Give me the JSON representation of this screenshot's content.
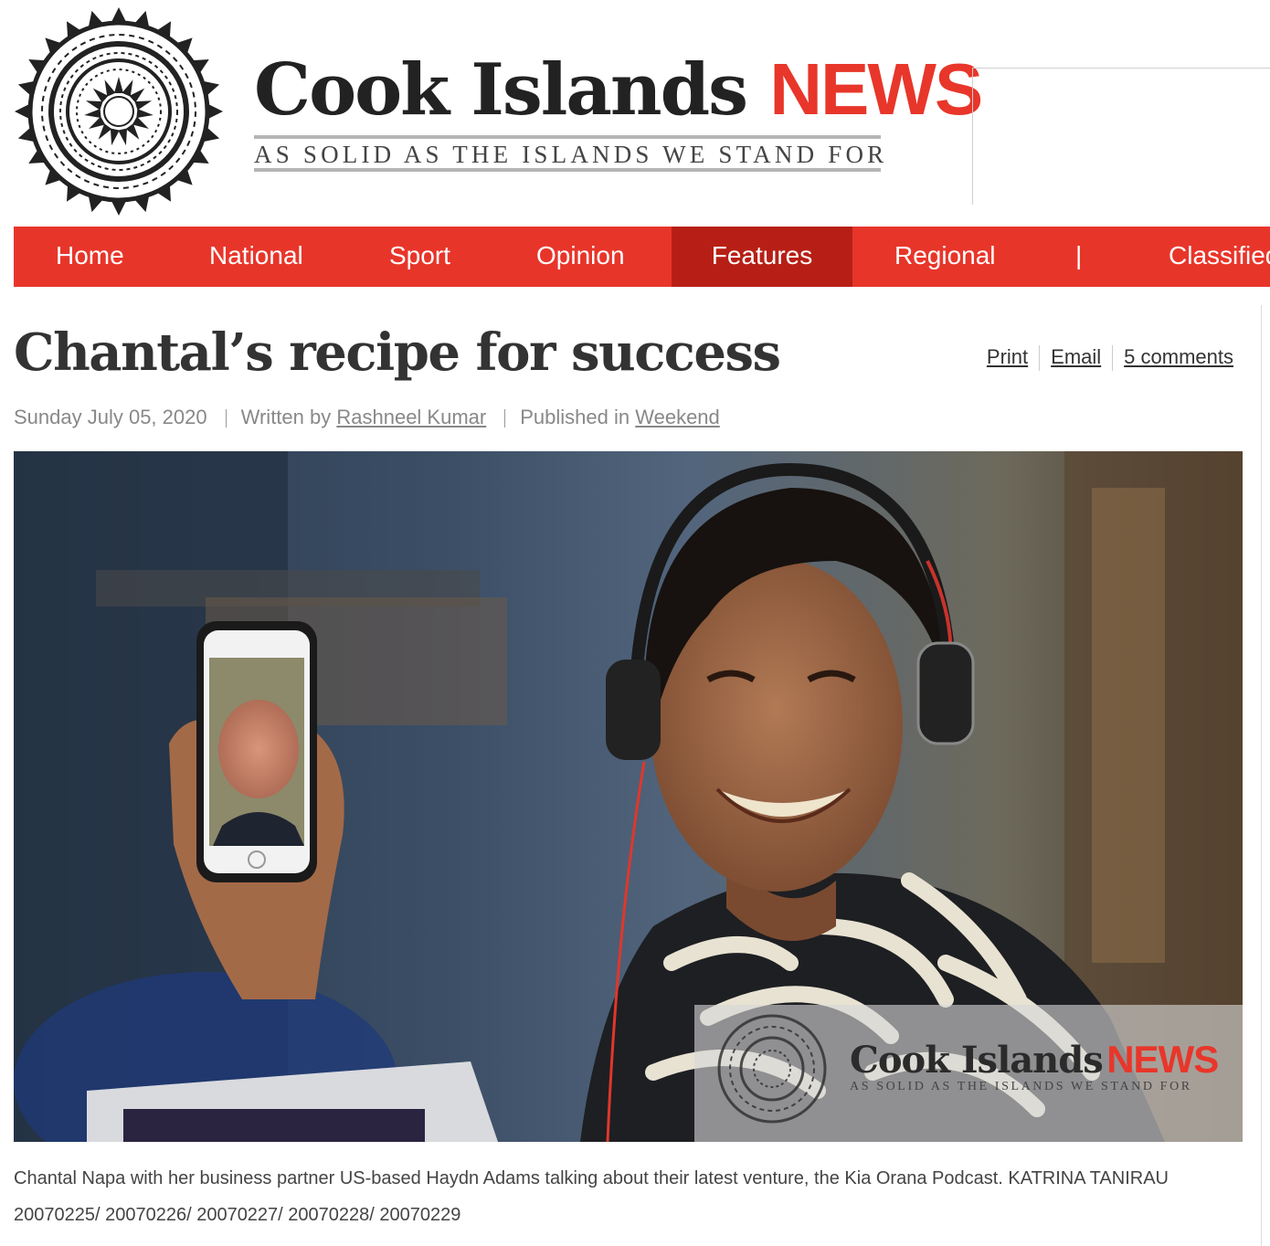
{
  "header": {
    "brand_name": "Cook Islands",
    "brand_news": "NEWS",
    "tagline": "AS SOLID AS THE ISLANDS WE STAND FOR"
  },
  "nav": {
    "items": [
      {
        "label": "Home"
      },
      {
        "label": "National"
      },
      {
        "label": "Sport"
      },
      {
        "label": "Opinion"
      },
      {
        "label": "Features",
        "active": true
      },
      {
        "label": "Regional"
      },
      {
        "label": "|"
      },
      {
        "label": "Classified"
      }
    ]
  },
  "article": {
    "title": "Chantal’s recipe for success",
    "tools": {
      "print": "Print",
      "email": "Email",
      "comments": "5 comments"
    },
    "meta": {
      "date": "Sunday July 05, 2020",
      "written_by_label": "Written by",
      "author": "Rashneel Kumar",
      "published_in_label": "Published in",
      "section": "Weekend"
    },
    "watermark": {
      "brand_name": "Cook Islands",
      "brand_news": "NEWS",
      "tagline": "AS SOLID AS THE ISLANDS WE STAND FOR"
    },
    "caption_line1": "Chantal Napa with her business partner US-based Haydn Adams talking about their latest venture, the Kia Orana Podcast. KATRINA TANIRAU",
    "caption_line2": "20070225/ 20070226/ 20070227/ 20070228/ 20070229"
  },
  "colors": {
    "brand_red": "#e8352a",
    "nav_active": "#b71f16",
    "text_dark": "#333333",
    "meta_gray": "#888888"
  }
}
